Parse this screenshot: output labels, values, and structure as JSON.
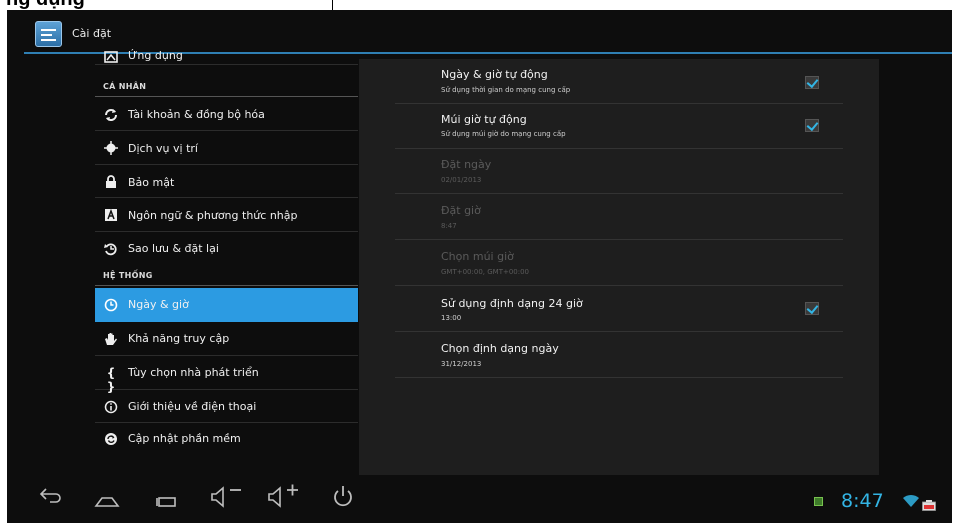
{
  "banner": {
    "text": "ng dụng"
  },
  "actionbar": {
    "title": "Cài đặt"
  },
  "left": {
    "top_item": "Ứng dụng",
    "header_personal": "CÁ NHÂN",
    "personal_items": [
      {
        "label": "Tài khoản & đồng bộ hóa",
        "icon": "sync-icon"
      },
      {
        "label": "Dịch vụ vị trí",
        "icon": "location-icon"
      },
      {
        "label": "Bảo mật",
        "icon": "lock-icon"
      },
      {
        "label": "Ngôn ngữ & phương thức nhập",
        "icon": "keyboard-a-icon"
      },
      {
        "label": "Sao lưu & đặt lại",
        "icon": "backup-icon"
      }
    ],
    "header_system": "HỆ THỐNG",
    "system_items": [
      {
        "label": "Ngày & giờ",
        "icon": "clock-icon",
        "selected": true
      },
      {
        "label": "Khả năng truy cập",
        "icon": "hand-icon"
      },
      {
        "label": "Tùy chọn nhà phát triển",
        "icon": "braces-icon"
      },
      {
        "label": "Giới thiệu về điện thoại",
        "icon": "info-icon"
      },
      {
        "label": "Cập nhật phần mềm",
        "icon": "update-icon"
      }
    ]
  },
  "right": {
    "settings": [
      {
        "title": "Ngày & giờ tự động",
        "summary": "Sử dụng thời gian do mạng cung cấp",
        "checked": true,
        "enabled": true
      },
      {
        "title": "Múi giờ tự động",
        "summary": "Sử dụng múi giờ do mạng cung cấp",
        "checked": true,
        "enabled": true
      },
      {
        "title": "Đặt ngày",
        "summary": "02/01/2013",
        "enabled": false
      },
      {
        "title": "Đặt giờ",
        "summary": "8:47",
        "enabled": false
      },
      {
        "title": "Chọn múi giờ",
        "summary": "GMT+00:00, GMT+00:00",
        "enabled": false
      },
      {
        "title": "Sử dụng định dạng 24 giờ",
        "summary": "13:00",
        "checked": true,
        "enabled": true
      },
      {
        "title": "Chọn định dạng ngày",
        "summary": "31/12/2013",
        "enabled": true
      }
    ]
  },
  "navbar": {
    "buttons": [
      "back-icon",
      "home-icon",
      "recent-apps-icon",
      "volume-down-icon",
      "volume-up-icon",
      "power-icon"
    ],
    "clock": "8:47"
  },
  "colors": {
    "accent": "#33b5e5",
    "selected": "#2c9be2",
    "background": "#0d0d0d",
    "panel": "#1e1e1e"
  }
}
